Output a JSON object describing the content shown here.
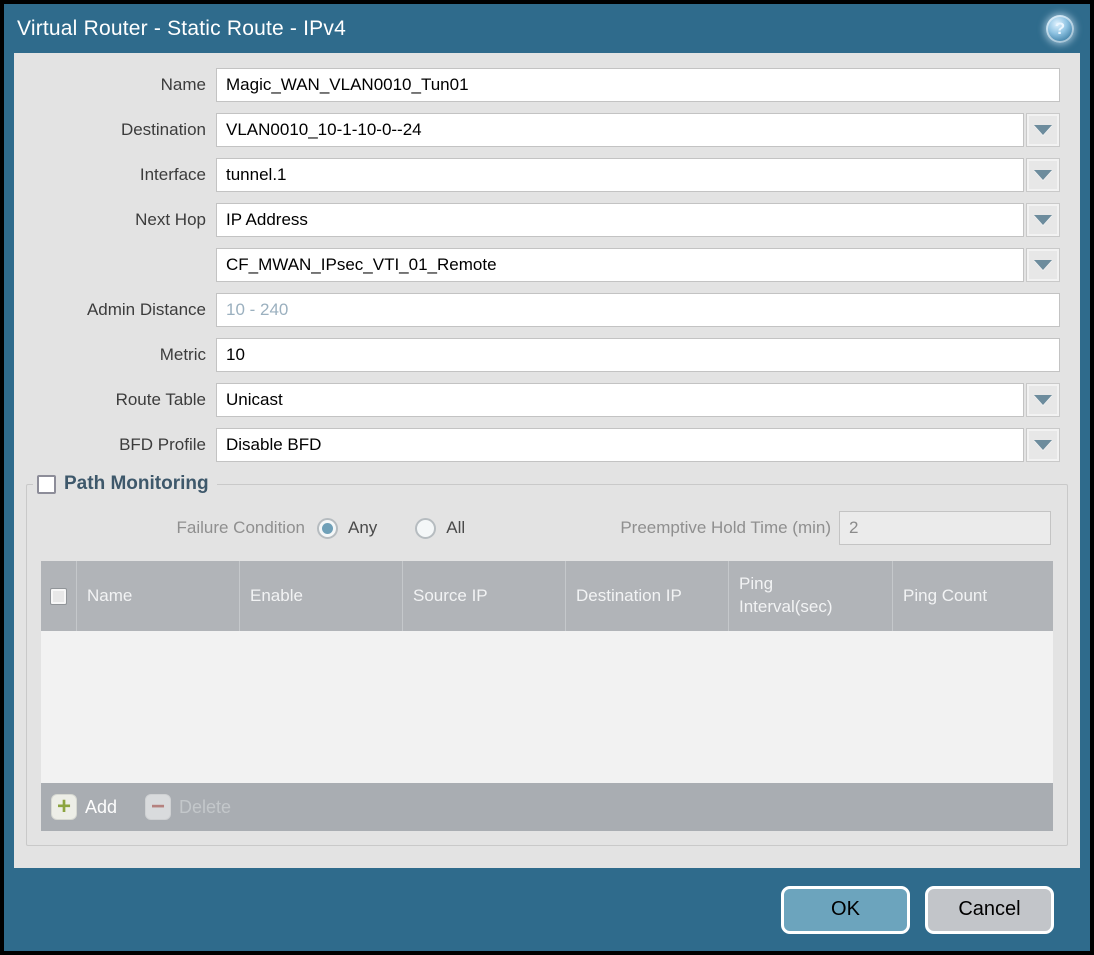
{
  "dialog": {
    "title": "Virtual Router - Static Route - IPv4",
    "help_icon_glyph": "?"
  },
  "fields": {
    "name": {
      "label": "Name",
      "value": "Magic_WAN_VLAN0010_Tun01"
    },
    "destination": {
      "label": "Destination",
      "value": "VLAN0010_10-1-10-0--24"
    },
    "interface": {
      "label": "Interface",
      "value": "tunnel.1"
    },
    "next_hop": {
      "label": "Next Hop",
      "value": "IP Address"
    },
    "next_hop_address": {
      "value": "CF_MWAN_IPsec_VTI_01_Remote"
    },
    "admin_distance": {
      "label": "Admin Distance",
      "value": "",
      "placeholder": "10 - 240"
    },
    "metric": {
      "label": "Metric",
      "value": "10"
    },
    "route_table": {
      "label": "Route Table",
      "value": "Unicast"
    },
    "bfd_profile": {
      "label": "BFD Profile",
      "value": "Disable BFD"
    }
  },
  "path_monitoring": {
    "title": "Path Monitoring",
    "checked": false,
    "failure_condition": {
      "label": "Failure Condition",
      "options": [
        {
          "label": "Any",
          "selected": true
        },
        {
          "label": "All",
          "selected": false
        }
      ]
    },
    "preemptive_hold_time": {
      "label": "Preemptive Hold Time (min)",
      "value": "2",
      "disabled": true
    },
    "table": {
      "columns": [
        "Name",
        "Enable",
        "Source IP",
        "Destination IP",
        "Ping Interval(sec)",
        "Ping Count"
      ],
      "rows": []
    },
    "toolbar": {
      "add_label": "Add",
      "add_icon": "plus-icon",
      "delete_label": "Delete",
      "delete_icon": "minus-icon",
      "delete_disabled": true
    }
  },
  "footer": {
    "ok_label": "OK",
    "cancel_label": "Cancel"
  },
  "colors": {
    "title_bar": "#2f6b8c",
    "content_bg": "#e3e3e3",
    "table_header_bg": "#b1b4b8",
    "ok_button": "#6ca4bd",
    "cancel_button": "#c2c5c9",
    "radio_selected": "#6fa0b8",
    "add_plus": "#8ca440",
    "delete_minus": "#b5827f"
  }
}
